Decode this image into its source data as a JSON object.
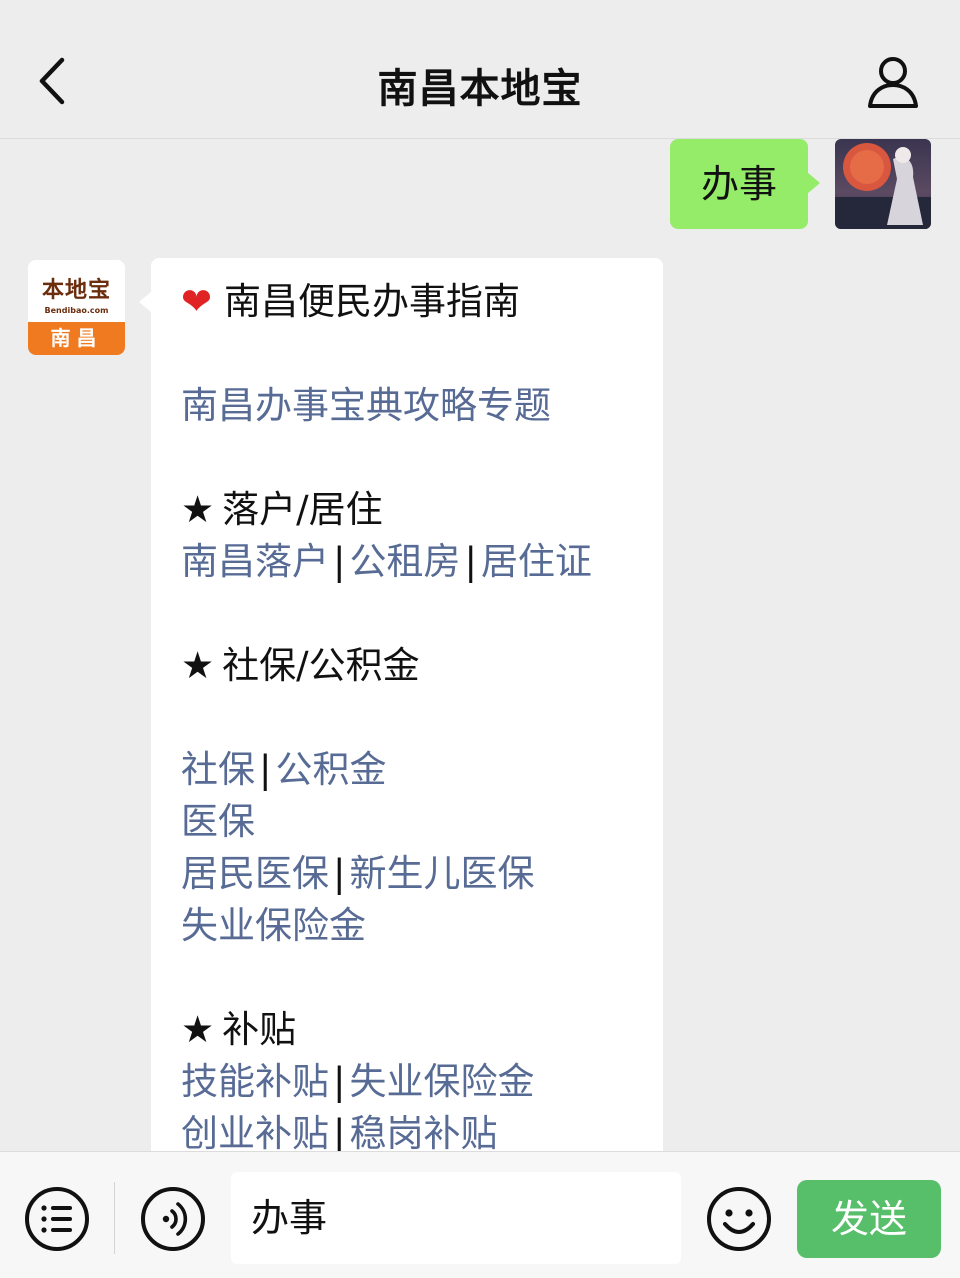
{
  "header": {
    "title": "南昌本地宝"
  },
  "outgoing_message": {
    "text": "办事"
  },
  "bot": {
    "avatar_logo_cn": "本地宝",
    "avatar_logo_en": "Bendibao.com",
    "avatar_city": "南昌"
  },
  "message": {
    "heart_icon": "❤",
    "title": "南昌便民办事指南",
    "topic_link": "南昌办事宝典攻略专题",
    "star_icon": "★",
    "separator": "|",
    "section1": {
      "heading": "落户/居住",
      "links": [
        "南昌落户",
        "公租房",
        "居住证"
      ]
    },
    "section2": {
      "heading": "社保/公积金"
    },
    "row_a": [
      "社保",
      "公积金"
    ],
    "row_b": "医保",
    "row_c": [
      "居民医保",
      "新生儿医保"
    ],
    "row_d": "失业保险金",
    "section3": {
      "heading": "补贴"
    },
    "row_e": [
      "技能补贴",
      "失业保险金"
    ],
    "row_f": [
      "创业补贴",
      "稳岗补贴"
    ]
  },
  "input": {
    "value": "办事",
    "send_label": "发送"
  },
  "colors": {
    "link": "#576b95",
    "outgoing_bubble": "#95ec69",
    "send_button": "#57be6a",
    "background": "#ededed"
  }
}
